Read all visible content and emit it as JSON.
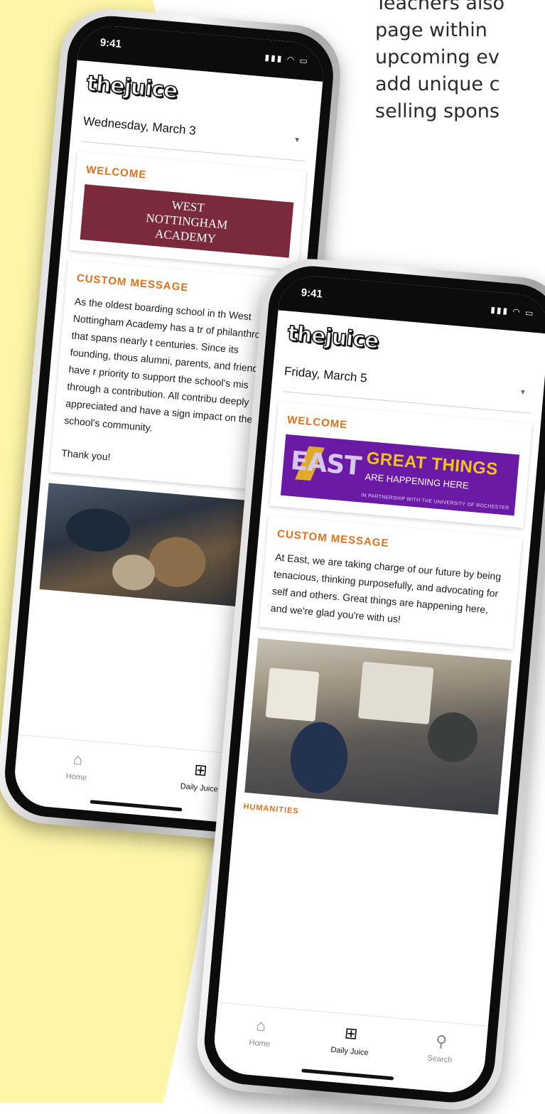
{
  "intro_text": {
    "lines": [
      "Teachers also",
      "page within",
      "upcoming ev",
      "add unique c",
      "selling spons"
    ]
  },
  "colors": {
    "background_accent": "#fdf6a8",
    "section_heading": "#e0701c",
    "west_banner": "#7a2a3a",
    "east_banner": "#6a1aa4",
    "east_headline": "#f3c318"
  },
  "phone_back": {
    "status": {
      "time": "9:41",
      "icons": "signal wifi battery"
    },
    "logo": "thejuice",
    "date": "Wednesday, March 3",
    "welcome": {
      "title": "WELCOME",
      "banner_lines": [
        "WEST",
        "NOTTINGHAM",
        "ACADEMY"
      ]
    },
    "custom_message": {
      "title": "CUSTOM MESSAGE",
      "paragraph": "As the oldest boarding school in th West Nottingham Academy has a tr of philanthropy that spans nearly t centuries. Since its founding, thous alumni, parents, and friends have r priority to support the school's mis through a contribution. All contribu deeply appreciated and have a sign impact on the school's community.",
      "closing": "Thank you!"
    },
    "photo_alt": "food-drive-photo",
    "tabs": [
      {
        "label": "Home",
        "icon": "home-icon"
      },
      {
        "label": "Daily Juice",
        "icon": "juice-cup-icon"
      }
    ]
  },
  "phone_front": {
    "status": {
      "time": "9:41",
      "icons": "signal wifi battery"
    },
    "logo": "thejuice",
    "date": "Friday, March 5",
    "welcome": {
      "title": "WELCOME",
      "east_word": "EAST",
      "headline": "GREAT THINGS",
      "subline": "ARE HAPPENING HERE",
      "partner": "IN PARTNERSHIP WITH THE UNIVERSITY OF ROCHESTER"
    },
    "custom_message": {
      "title": "CUSTOM MESSAGE",
      "paragraph": "At East, we are taking charge of our future by being tenacious, thinking purposefully, and advocating for self and others. Great things are happening here, and we're glad you're with us!"
    },
    "photo_alt": "classroom-photo",
    "section_label": "HUMANITIES",
    "tabs": [
      {
        "label": "Home",
        "icon": "home-icon"
      },
      {
        "label": "Daily Juice",
        "icon": "juice-cup-icon"
      },
      {
        "label": "Search",
        "icon": "search-icon"
      }
    ]
  }
}
